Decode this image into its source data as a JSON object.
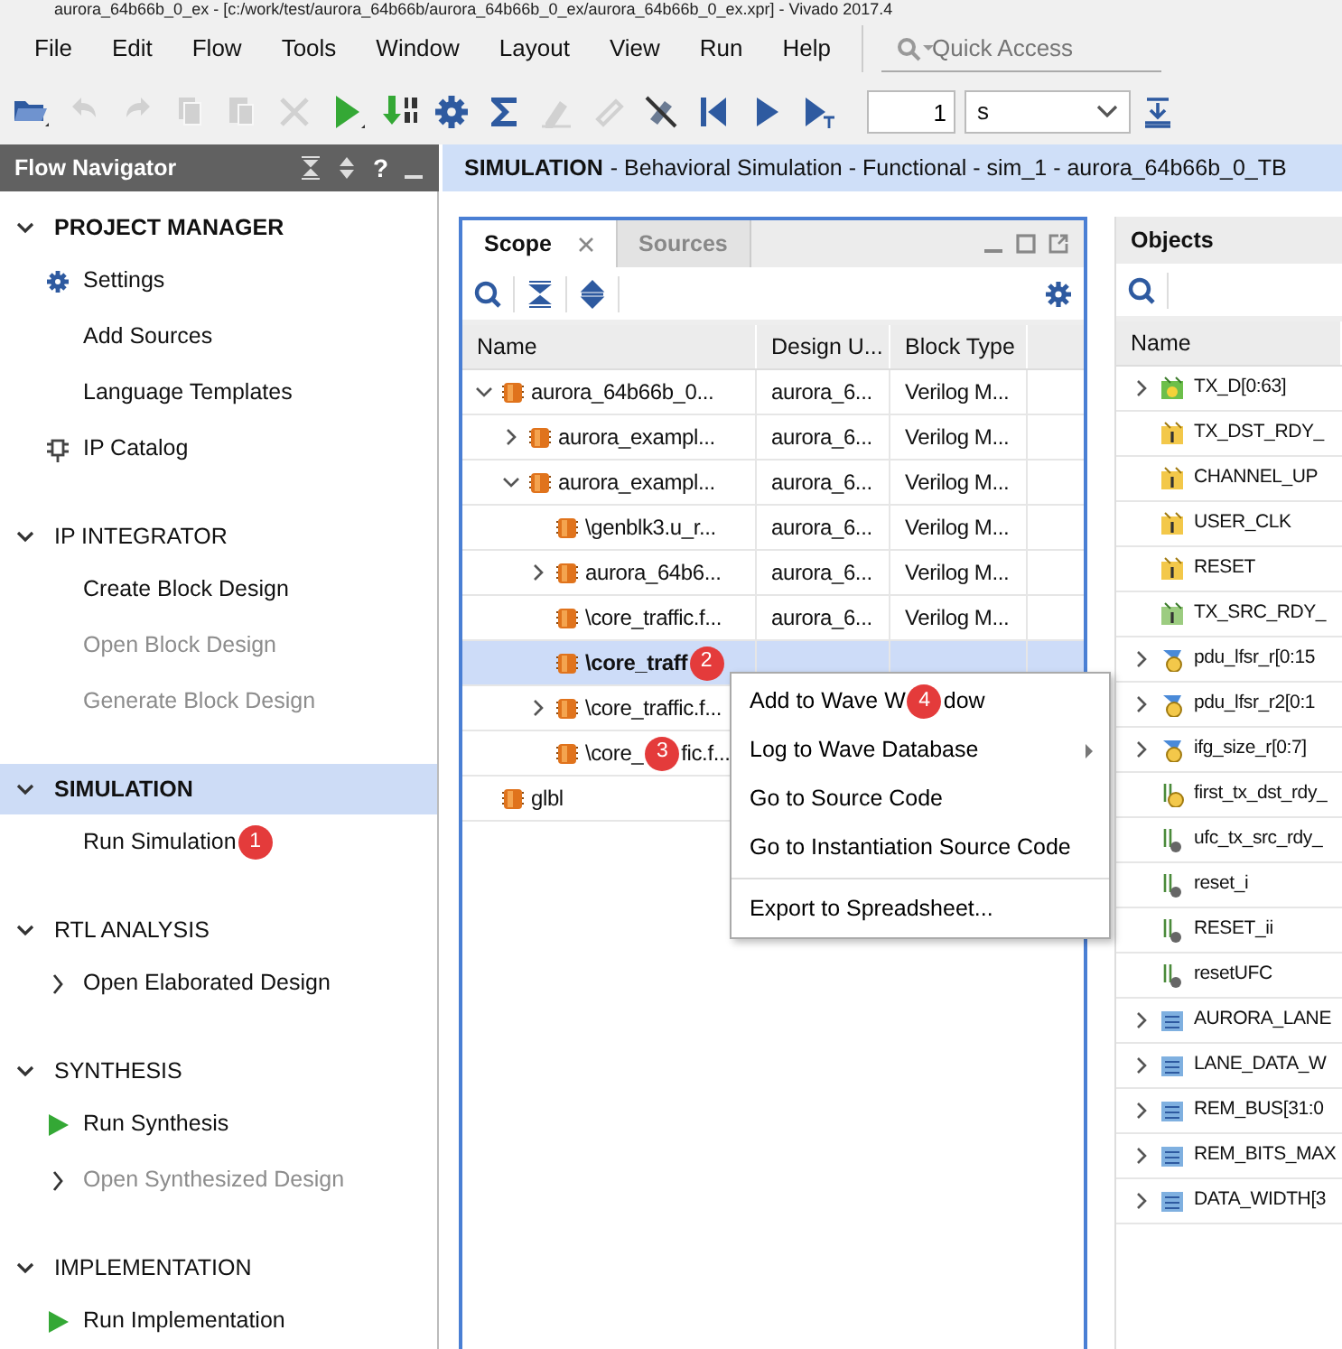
{
  "window": {
    "title": "aurora_64b66b_0_ex - [c:/work/test/aurora_64b66b/aurora_64b66b_0_ex/aurora_64b66b_0_ex.xpr] - Vivado 2017.4"
  },
  "menu": [
    "File",
    "Edit",
    "Flow",
    "Tools",
    "Window",
    "Layout",
    "View",
    "Run",
    "Help"
  ],
  "quick_access": {
    "placeholder": "Quick Access"
  },
  "toolbar": {
    "buttons": [
      {
        "kind": "open",
        "disabled": false
      },
      {
        "kind": "undo",
        "disabled": true
      },
      {
        "kind": "redo",
        "disabled": true
      },
      {
        "kind": "copy",
        "disabled": true
      },
      {
        "kind": "paste",
        "disabled": true
      },
      {
        "kind": "delete",
        "disabled": true
      },
      {
        "kind": "run",
        "disabled": false
      },
      {
        "kind": "compile",
        "disabled": false
      },
      {
        "kind": "settings",
        "disabled": false
      },
      {
        "kind": "sigma",
        "disabled": false
      },
      {
        "kind": "marker",
        "disabled": true
      },
      {
        "kind": "link",
        "disabled": true
      },
      {
        "kind": "break",
        "disabled": false
      },
      {
        "kind": "restart",
        "disabled": false
      },
      {
        "kind": "play",
        "disabled": false
      },
      {
        "kind": "run_for",
        "disabled": false
      }
    ],
    "time_value": "1",
    "time_unit": "s"
  },
  "flow_navigator": {
    "title": "Flow Navigator",
    "help": "?",
    "sections": [
      {
        "title": "PROJECT MANAGER",
        "bold": true,
        "selected": false,
        "items": [
          {
            "label": "Settings",
            "kind": "settings",
            "disabled": false
          },
          {
            "label": "Add Sources",
            "kind": "plain",
            "disabled": false
          },
          {
            "label": "Language Templates",
            "kind": "plain",
            "disabled": false
          },
          {
            "label": "IP Catalog",
            "kind": "catalog",
            "disabled": false
          }
        ]
      },
      {
        "title": "IP INTEGRATOR",
        "bold": false,
        "selected": false,
        "items": [
          {
            "label": "Create Block Design",
            "kind": "plain",
            "disabled": false
          },
          {
            "label": "Open Block Design",
            "kind": "plain",
            "disabled": true
          },
          {
            "label": "Generate Block Design",
            "kind": "plain",
            "disabled": true
          }
        ]
      },
      {
        "title": "SIMULATION",
        "bold": true,
        "selected": true,
        "items": [
          {
            "label": "Run Simulation",
            "kind": "plain",
            "disabled": false,
            "badge": "1"
          }
        ]
      },
      {
        "title": "RTL ANALYSIS",
        "bold": false,
        "selected": false,
        "items": [
          {
            "label": "Open Elaborated Design",
            "kind": "expand",
            "disabled": false
          }
        ]
      },
      {
        "title": "SYNTHESIS",
        "bold": false,
        "selected": false,
        "items": [
          {
            "label": "Run Synthesis",
            "kind": "run",
            "disabled": false
          },
          {
            "label": "Open Synthesized Design",
            "kind": "expand",
            "disabled": true
          }
        ]
      },
      {
        "title": "IMPLEMENTATION",
        "bold": false,
        "selected": false,
        "items": [
          {
            "label": "Run Implementation",
            "kind": "run",
            "disabled": false
          }
        ]
      }
    ]
  },
  "breadcrumb": {
    "section": "SIMULATION",
    "text": "- Behavioral Simulation - Functional - sim_1 - aurora_64b66b_0_TB"
  },
  "scope_panel": {
    "tabs": [
      {
        "label": "Scope",
        "selected": true,
        "closable": true
      },
      {
        "label": "Sources",
        "selected": false,
        "closable": false
      }
    ],
    "columns": [
      "Name",
      "Design U...",
      "Block Type"
    ],
    "rows": [
      {
        "name": "aurora_64b66b_0...",
        "design_unit": "aurora_6...",
        "block_type": "Verilog M...",
        "expanded": true,
        "selected": false,
        "children": [
          {
            "name": "aurora_exampl...",
            "design_unit": "aurora_6...",
            "block_type": "Verilog M...",
            "expanded": false,
            "selected": false
          },
          {
            "name": "aurora_exampl...",
            "design_unit": "aurora_6...",
            "block_type": "Verilog M...",
            "expanded": true,
            "selected": false,
            "children": [
              {
                "name": "\\genblk3.u_r...",
                "design_unit": "aurora_6...",
                "block_type": "Verilog M...",
                "selected": false
              },
              {
                "name": "aurora_64b6...",
                "design_unit": "aurora_6...",
                "block_type": "Verilog M...",
                "expanded": false,
                "selected": false
              },
              {
                "name": "\\core_traffic.f...",
                "design_unit": "aurora_6...",
                "block_type": "Verilog M...",
                "selected": false
              },
              {
                "name": "\\core_traff",
                "selected": true,
                "badge": "2"
              },
              {
                "name": "\\core_traffic.f...",
                "expanded": false,
                "selected": false
              },
              {
                "name": "\\core_",
                "selected": false,
                "badge": "3",
                "name_after_badge": "fic.f..."
              }
            ]
          }
        ]
      },
      {
        "name": "glbl",
        "selected": false
      }
    ]
  },
  "objects_panel": {
    "title": "Objects",
    "columns": [
      "Name"
    ],
    "rows": [
      {
        "name": "TX_D[0:63]",
        "kind": "bus_in",
        "expanded": false
      },
      {
        "name": "TX_DST_RDY_",
        "kind": "port"
      },
      {
        "name": "CHANNEL_UP",
        "kind": "port"
      },
      {
        "name": "USER_CLK",
        "kind": "port"
      },
      {
        "name": "RESET",
        "kind": "port"
      },
      {
        "name": "TX_SRC_RDY_",
        "kind": "port_in"
      },
      {
        "name": "pdu_lfsr_r[0:15",
        "kind": "bus_reg",
        "expanded": false
      },
      {
        "name": "pdu_lfsr_r2[0:1",
        "kind": "bus_reg",
        "expanded": false
      },
      {
        "name": "ifg_size_r[0:7]",
        "kind": "bus_reg",
        "expanded": false
      },
      {
        "name": "first_tx_dst_rdy_",
        "kind": "reg"
      },
      {
        "name": "ufc_tx_src_rdy_",
        "kind": "wire"
      },
      {
        "name": "reset_i",
        "kind": "wire"
      },
      {
        "name": "RESET_ii",
        "kind": "wire"
      },
      {
        "name": "resetUFC",
        "kind": "wire"
      },
      {
        "name": "AURORA_LANE",
        "kind": "param",
        "expanded": false
      },
      {
        "name": "LANE_DATA_W",
        "kind": "param",
        "expanded": false
      },
      {
        "name": "REM_BUS[31:0",
        "kind": "param",
        "expanded": false
      },
      {
        "name": "REM_BITS_MAX",
        "kind": "param",
        "expanded": false
      },
      {
        "name": "DATA_WIDTH[3",
        "kind": "param",
        "expanded": false
      }
    ]
  },
  "context_menu": {
    "items": [
      {
        "label": "Add to Wave W",
        "submenu": false,
        "divider_before": false,
        "badge": "4",
        "label_after_badge": "dow"
      },
      {
        "label": "Log to Wave Database",
        "submenu": true,
        "divider_before": false
      },
      {
        "label": "Go to Source Code",
        "submenu": false,
        "divider_before": false
      },
      {
        "label": "Go to Instantiation Source Code",
        "submenu": false,
        "divider_before": false
      },
      {
        "label": "Export to Spreadsheet...",
        "submenu": false,
        "divider_before": true
      }
    ]
  }
}
